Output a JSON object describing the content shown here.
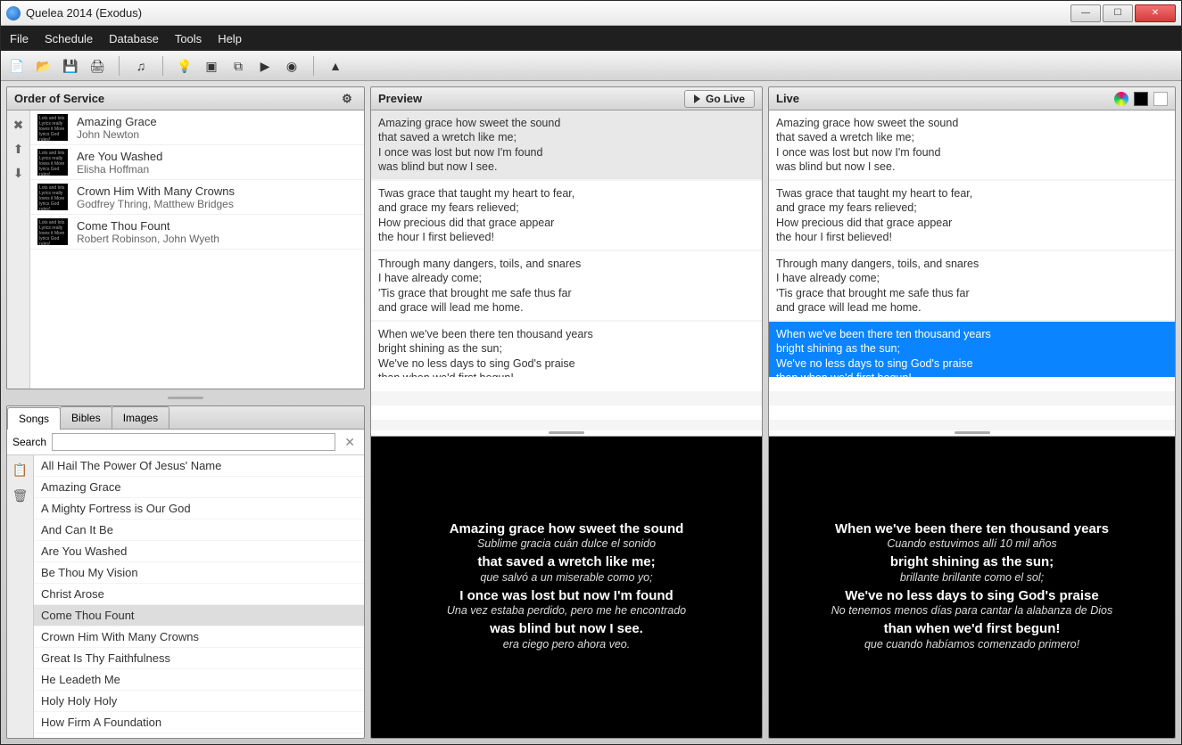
{
  "window": {
    "title": "Quelea 2014 (Exodus)"
  },
  "menu": {
    "file": "File",
    "schedule": "Schedule",
    "database": "Database",
    "tools": "Tools",
    "help": "Help"
  },
  "panels": {
    "order": {
      "title": "Order of Service"
    },
    "preview": {
      "title": "Preview",
      "golive": "Go Live"
    },
    "live": {
      "title": "Live"
    }
  },
  "orderOfService": [
    {
      "title": "Amazing Grace",
      "author": "John Newton"
    },
    {
      "title": "Are You Washed",
      "author": "Elisha Hoffman"
    },
    {
      "title": "Crown Him With Many Crowns",
      "author": "Godfrey Thring, Matthew Bridges"
    },
    {
      "title": "Come Thou Fount",
      "author": "Robert Robinson, John Wyeth"
    }
  ],
  "tabs": {
    "songs": "Songs",
    "bibles": "Bibles",
    "images": "Images"
  },
  "search": {
    "label": "Search",
    "value": ""
  },
  "songList": [
    "All Hail The Power Of Jesus' Name",
    "Amazing Grace",
    "A Mighty Fortress is Our God",
    "And Can It Be",
    "Are You Washed",
    "Be Thou My Vision",
    "Christ Arose",
    "Come Thou Fount",
    "Crown Him With Many Crowns",
    "Great Is Thy Faithfulness",
    "He Leadeth Me",
    "Holy Holy Holy",
    "How Firm A Foundation"
  ],
  "songListSelected": "Come Thou Fount",
  "verses": [
    "Amazing grace how sweet the sound\nthat saved a wretch like me;\nI once was lost but now I'm found\nwas blind but now I see.",
    "Twas grace that taught my heart to fear,\nand grace my fears relieved;\nHow precious did that grace appear\nthe hour I first believed!",
    "Through many dangers, toils, and snares\nI have already come;\n'Tis grace that brought me safe thus far\nand grace will lead me home.",
    "When we've been there ten thousand years\nbright shining as the sun;\nWe've no less days to sing God's praise\nthan when we'd first begun!"
  ],
  "previewSelectedIndex": 0,
  "liveSelectedIndex": 3,
  "previewDisplay": [
    {
      "main": "Amazing grace how sweet the sound",
      "trans": "Sublime gracia cuán dulce el sonido"
    },
    {
      "main": "that saved a wretch like me;",
      "trans": "que salvó a un miserable como yo;"
    },
    {
      "main": "I once was lost but now I'm found",
      "trans": "Una vez estaba perdido, pero me he encontrado"
    },
    {
      "main": "was blind but now I see.",
      "trans": "era ciego pero ahora veo."
    }
  ],
  "liveDisplay": [
    {
      "main": "When we've been there ten thousand years",
      "trans": "Cuando estuvimos allí 10 mil años"
    },
    {
      "main": "bright shining as the sun;",
      "trans": "brillante brillante como el sol;"
    },
    {
      "main": "We've no less days to sing God's praise",
      "trans": "No tenemos menos días para cantar la alabanza de Dios"
    },
    {
      "main": "than when we'd first begun!",
      "trans": "que cuando habíamos comenzado primero!"
    }
  ]
}
